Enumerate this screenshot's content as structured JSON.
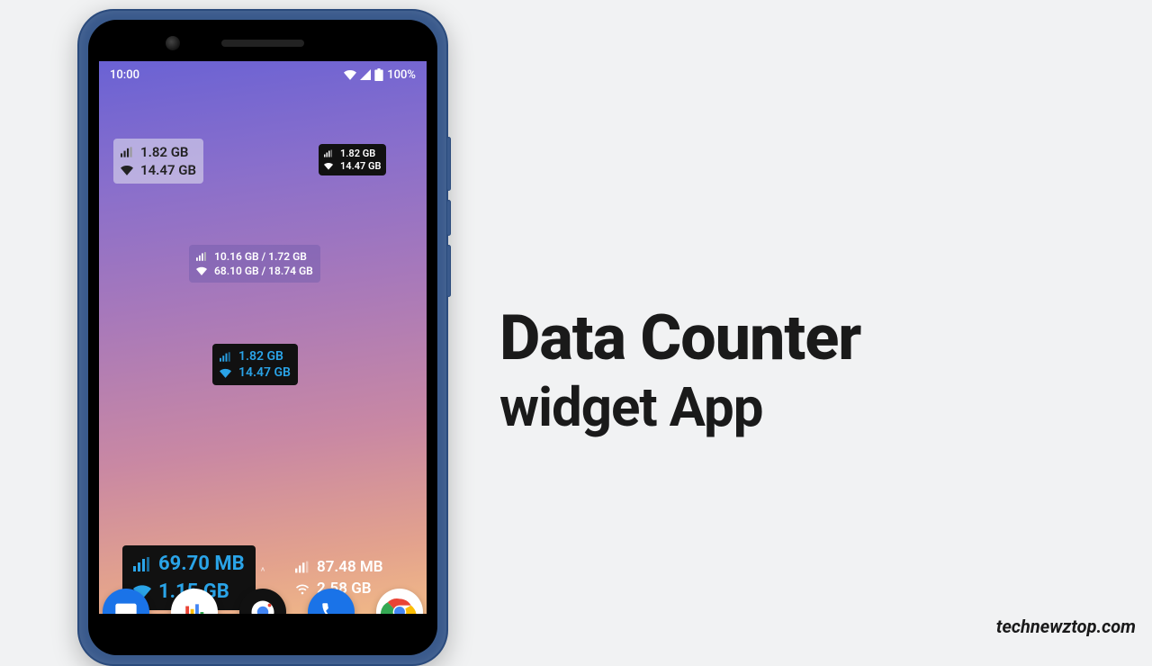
{
  "page": {
    "title_line1": "Data Counter",
    "title_line2": "widget App",
    "watermark": "technewztop.com"
  },
  "statusbar": {
    "time": "10:00",
    "battery": "100%"
  },
  "widgets": {
    "light": {
      "mobile": "1.82 GB",
      "wifi": "14.47 GB"
    },
    "dark_small": {
      "mobile": "1.82 GB",
      "wifi": "14.47 GB"
    },
    "purple": {
      "mobile": "10.16 GB / 1.72 GB",
      "wifi": "68.10 GB / 18.74 GB"
    },
    "black_blue": {
      "mobile": "1.82 GB",
      "wifi": "14.47 GB"
    },
    "big_black": {
      "mobile": "69.70 MB",
      "wifi": "1.15 GB"
    },
    "trans": {
      "mobile": "87.48 MB",
      "wifi": "2.58 GB"
    }
  },
  "indicator": "^"
}
